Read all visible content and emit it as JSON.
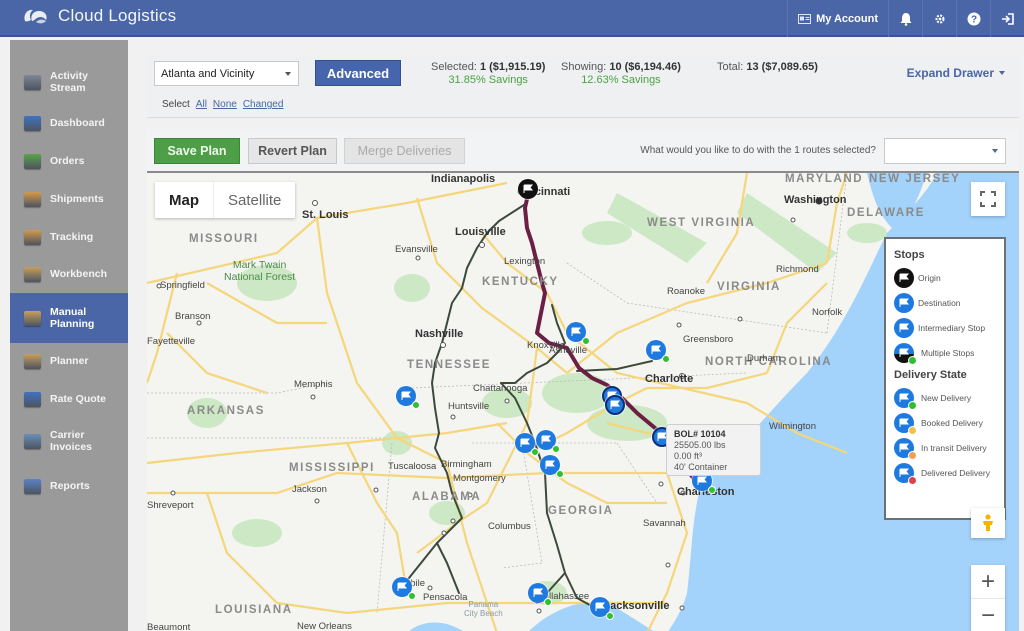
{
  "app": {
    "name": "Cloud Logistics",
    "logo_icon": "cloud-logistics-logo"
  },
  "topnav": {
    "my_account": "My Account",
    "icons": [
      "account-card-icon",
      "bell-icon",
      "gear-icon",
      "help-icon",
      "logout-icon"
    ]
  },
  "sidebar": {
    "items": [
      {
        "label": "Activity\nStream",
        "icon": "activity-stream-icon",
        "color": "#7d8796"
      },
      {
        "label": "Dashboard",
        "icon": "dashboard-icon",
        "color": "#3f72c2"
      },
      {
        "label": "Orders",
        "icon": "orders-icon",
        "color": "#5aa34a"
      },
      {
        "label": "Shipments",
        "icon": "shipments-icon",
        "color": "#d49a4a"
      },
      {
        "label": "Tracking",
        "icon": "tracking-icon",
        "color": "#d49a4a"
      },
      {
        "label": "Workbench",
        "icon": "workbench-icon",
        "color": "#c8a05a"
      },
      {
        "label": "Manual\nPlanning",
        "icon": "manual-planning-icon",
        "color": "#c8a05a",
        "active": true
      },
      {
        "label": "Planner",
        "icon": "planner-icon",
        "color": "#c8a05a"
      },
      {
        "label": "Rate Quote",
        "icon": "rate-quote-icon",
        "color": "#3f72c2"
      },
      {
        "label": "Carrier\nInvoices",
        "icon": "carrier-invoices-icon",
        "color": "#6a8fb8"
      },
      {
        "label": "Reports",
        "icon": "reports-icon",
        "color": "#5b82c6"
      }
    ]
  },
  "toolbar": {
    "region_value": "Atlanta and Vicinity",
    "advanced_label": "Advanced",
    "selected_label": "Selected:",
    "selected_value": "1 ($1,915.19)",
    "selected_savings": "31.85% Savings",
    "showing_label": "Showing:",
    "showing_value": "10 ($6,194.46)",
    "showing_savings": "12.63% Savings",
    "total_label": "Total:",
    "total_value": "13 ($7,089.65)",
    "expand_drawer": "Expand Drawer",
    "select_label": "Select",
    "select_all": "All",
    "select_none": "None",
    "select_changed": "Changed"
  },
  "actions": {
    "save_plan": "Save Plan",
    "revert_plan": "Revert Plan",
    "merge_deliveries": "Merge Deliveries",
    "question": "What would you like to do with the 1 routes selected?",
    "action_value": ""
  },
  "map": {
    "map_type": {
      "map": "Map",
      "satellite": "Satellite",
      "selected": "Map"
    },
    "labels": {
      "states": [
        "MISSOURI",
        "KENTUCKY",
        "WEST VIRGINIA",
        "VIRGINIA",
        "TENNESSEE",
        "NORTH CAROLINA",
        "ARKANSAS",
        "MISSISSIPPI",
        "ALABAMA",
        "GEORGIA",
        "LOUISIANA",
        "MARYLAND",
        "NEW JERSEY",
        "DELAWARE"
      ],
      "cities": [
        "Indianapolis",
        "Cincinnati",
        "St. Louis",
        "Louisville",
        "Nashville",
        "Charlotte",
        "Washington",
        "Charleston",
        "Jacksonville"
      ],
      "towns": [
        "Evansville",
        "Springfield",
        "Branson",
        "Fayetteville",
        "Lexington",
        "Knoxville",
        "Asheville",
        "Greensboro",
        "Durham",
        "Roanoke",
        "Richmond",
        "Norfolk",
        "Memphis",
        "Huntsville",
        "Chattanooga",
        "Birmingham",
        "Tuscaloosa",
        "Montgomery",
        "Columbus",
        "Jackson",
        "Shreveport",
        "Savannah",
        "Wilmington",
        "Mobile",
        "Pensacola",
        "Tallahassee",
        "New Orleans",
        "Beaumont"
      ],
      "parks": [
        "Mark Twain\nNational Forest"
      ],
      "water": [
        "Panama\nCity Beach"
      ]
    },
    "tooltip": {
      "bol": "BOL# 10104",
      "weight": "25505.00 lbs",
      "volume": "0.00 ft³",
      "equipment": "40' Container"
    },
    "legend": {
      "stops_title": "Stops",
      "stops": [
        {
          "label": "Origin",
          "icon": "origin-flag-icon",
          "color": "#111111"
        },
        {
          "label": "Destination",
          "icon": "destination-flag-icon",
          "color": "#1f7ae0"
        },
        {
          "label": "Intermediary Stop",
          "icon": "intermediary-flag-icon",
          "color": "#1f7ae0"
        },
        {
          "label": "Multiple Stops",
          "icon": "multiple-stops-icon",
          "color": "#1f7ae0",
          "dot": "#2ec02e"
        }
      ],
      "delivery_title": "Delivery State",
      "delivery": [
        {
          "label": "New Delivery",
          "icon": "new-delivery-icon",
          "dot": "#2ec02e"
        },
        {
          "label": "Booked Delivery",
          "icon": "booked-delivery-icon",
          "dot": "#f2c24a"
        },
        {
          "label": "In transit Delivery",
          "icon": "in-transit-delivery-icon",
          "dot": "#f0a050"
        },
        {
          "label": "Delivered Delivery",
          "icon": "delivered-delivery-icon",
          "dot": "#e0404a"
        }
      ]
    },
    "colors": {
      "selected_route": "#6b1f45",
      "other_routes": "#3c4a3c",
      "marker": "#1f7ae0",
      "new_delivery_dot": "#2ec02e"
    }
  }
}
